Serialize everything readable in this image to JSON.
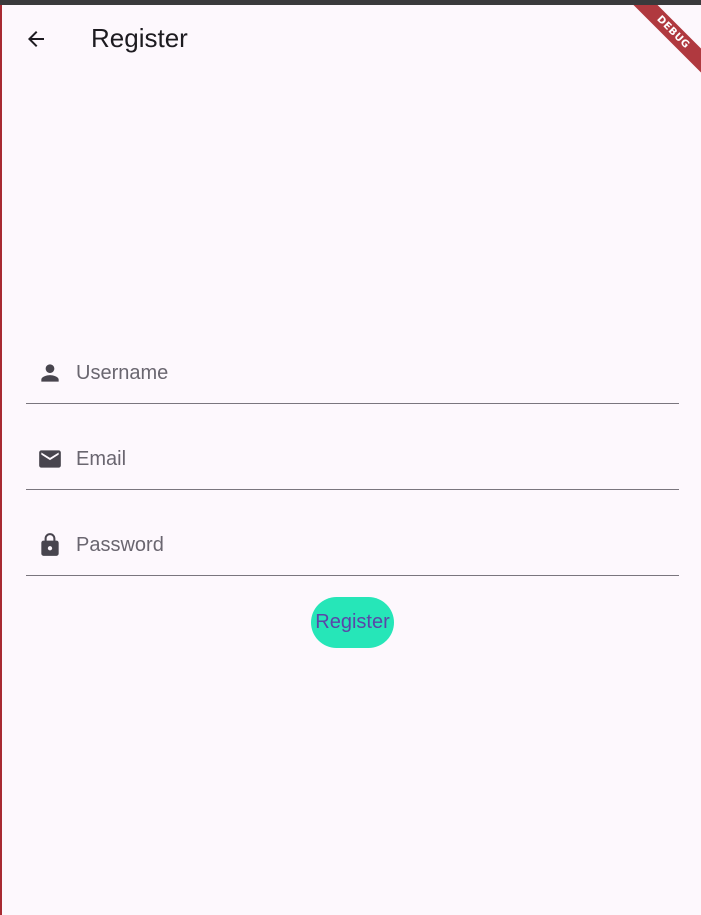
{
  "app_bar": {
    "title": "Register",
    "back_icon": "arrow-back-icon"
  },
  "debug_banner": {
    "label": "DEBUG",
    "color": "#b0393f"
  },
  "form": {
    "username": {
      "placeholder": "Username",
      "value": "",
      "icon": "person-icon"
    },
    "email": {
      "placeholder": "Email",
      "value": "",
      "icon": "mail-icon"
    },
    "password": {
      "placeholder": "Password",
      "value": "",
      "icon": "lock-icon"
    },
    "submit_label": "Register"
  },
  "colors": {
    "background": "#fdf8fd",
    "button_background": "#26e6b8",
    "button_text": "#5a46a8",
    "text": "#1d1b20"
  }
}
